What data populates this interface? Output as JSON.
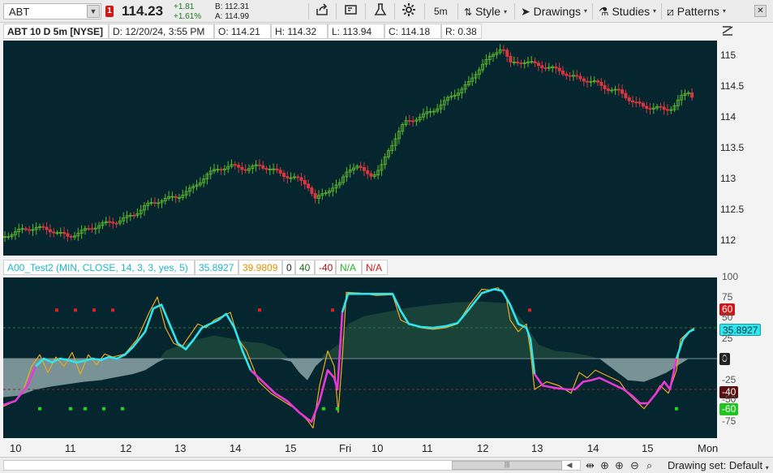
{
  "toolbar": {
    "symbol": "ABT",
    "alert_badge": "1",
    "last_price": "114.23",
    "net_change": "+1.81",
    "pct_change": "+1.61%",
    "bid": "B: 112.31",
    "ask": "A: 114.99",
    "timeframe": "5m",
    "style_label": "Style",
    "drawings_label": "Drawings",
    "studies_label": "Studies",
    "patterns_label": "Patterns"
  },
  "info": {
    "description": "ABT 10 D 5m [NYSE]",
    "date": "D: 12/20/24, 3:55 PM",
    "open": "O: 114.21",
    "high": "H: 114.32",
    "low": "L: 113.94",
    "close": "C: 114.18",
    "range": "R: 0.38"
  },
  "price_axis": [
    "115",
    "114.5",
    "114",
    "113.5",
    "113",
    "112.5",
    "112"
  ],
  "study": {
    "name": "A00_Test2 (MIN, CLOSE, 14, 3, 3, yes, 5)",
    "v1": "35.8927",
    "v2": "39.9809",
    "v3": "0",
    "v4": "40",
    "v5": "-40",
    "v6": "N/A",
    "v7": "N/A",
    "axis": [
      "100",
      "75",
      "50",
      "25",
      "0",
      "-25",
      "-50",
      "-75"
    ],
    "badge_60": "60",
    "badge_val": "35.8927",
    "badge_0": "0",
    "badge_m40": "-40",
    "badge_m60": "-60"
  },
  "x_axis": [
    "10",
    "11",
    "12",
    "13",
    "14",
    "15",
    "Fri",
    "10",
    "11",
    "12",
    "13",
    "14",
    "15",
    "Mon"
  ],
  "bottom": {
    "drawing_set": "Drawing set: Default"
  },
  "colors": {
    "pane_bg": "#06262f",
    "up": "#5dbb2b",
    "down": "#d9363e",
    "cyan": "#2ee6ee",
    "magenta": "#e838d8",
    "orange": "#f0a820"
  }
}
